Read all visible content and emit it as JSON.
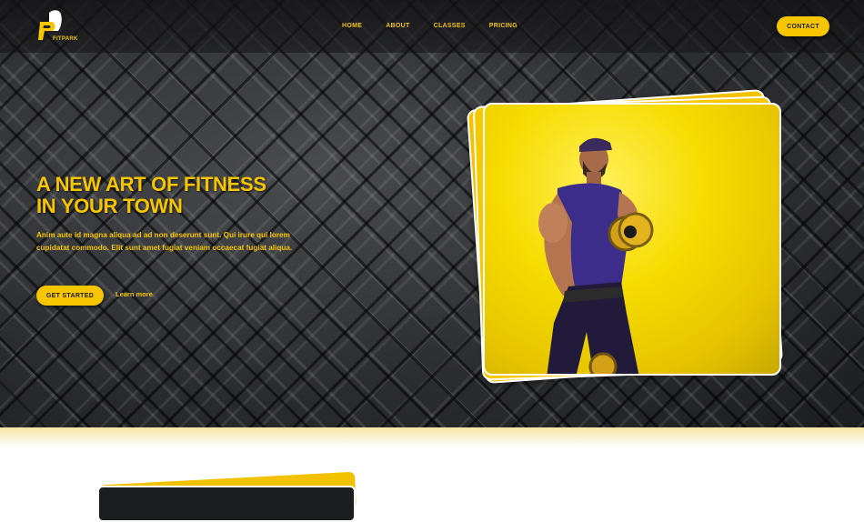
{
  "brand": {
    "name": "FITPARK",
    "accent": "#f7c600"
  },
  "nav": {
    "links": [
      "HOME",
      "ABOUT",
      "CLASSES",
      "PRICING"
    ],
    "contact_label": "CONTACT"
  },
  "hero": {
    "headline_line1": "A NEW ART OF FITNESS",
    "headline_line2": "IN YOUR TOWN",
    "description": "Anim aute id magna aliqua ad ad non deserunt sunt. Qui irure qui lorem cupidatat commodo. Elit sunt amet fugiat veniam occaecat fugiat aliqua.",
    "cta_label": "GET STARTED",
    "learn_more_label": "Learn more",
    "image_icon": "man-with-dumbbells-photo"
  }
}
